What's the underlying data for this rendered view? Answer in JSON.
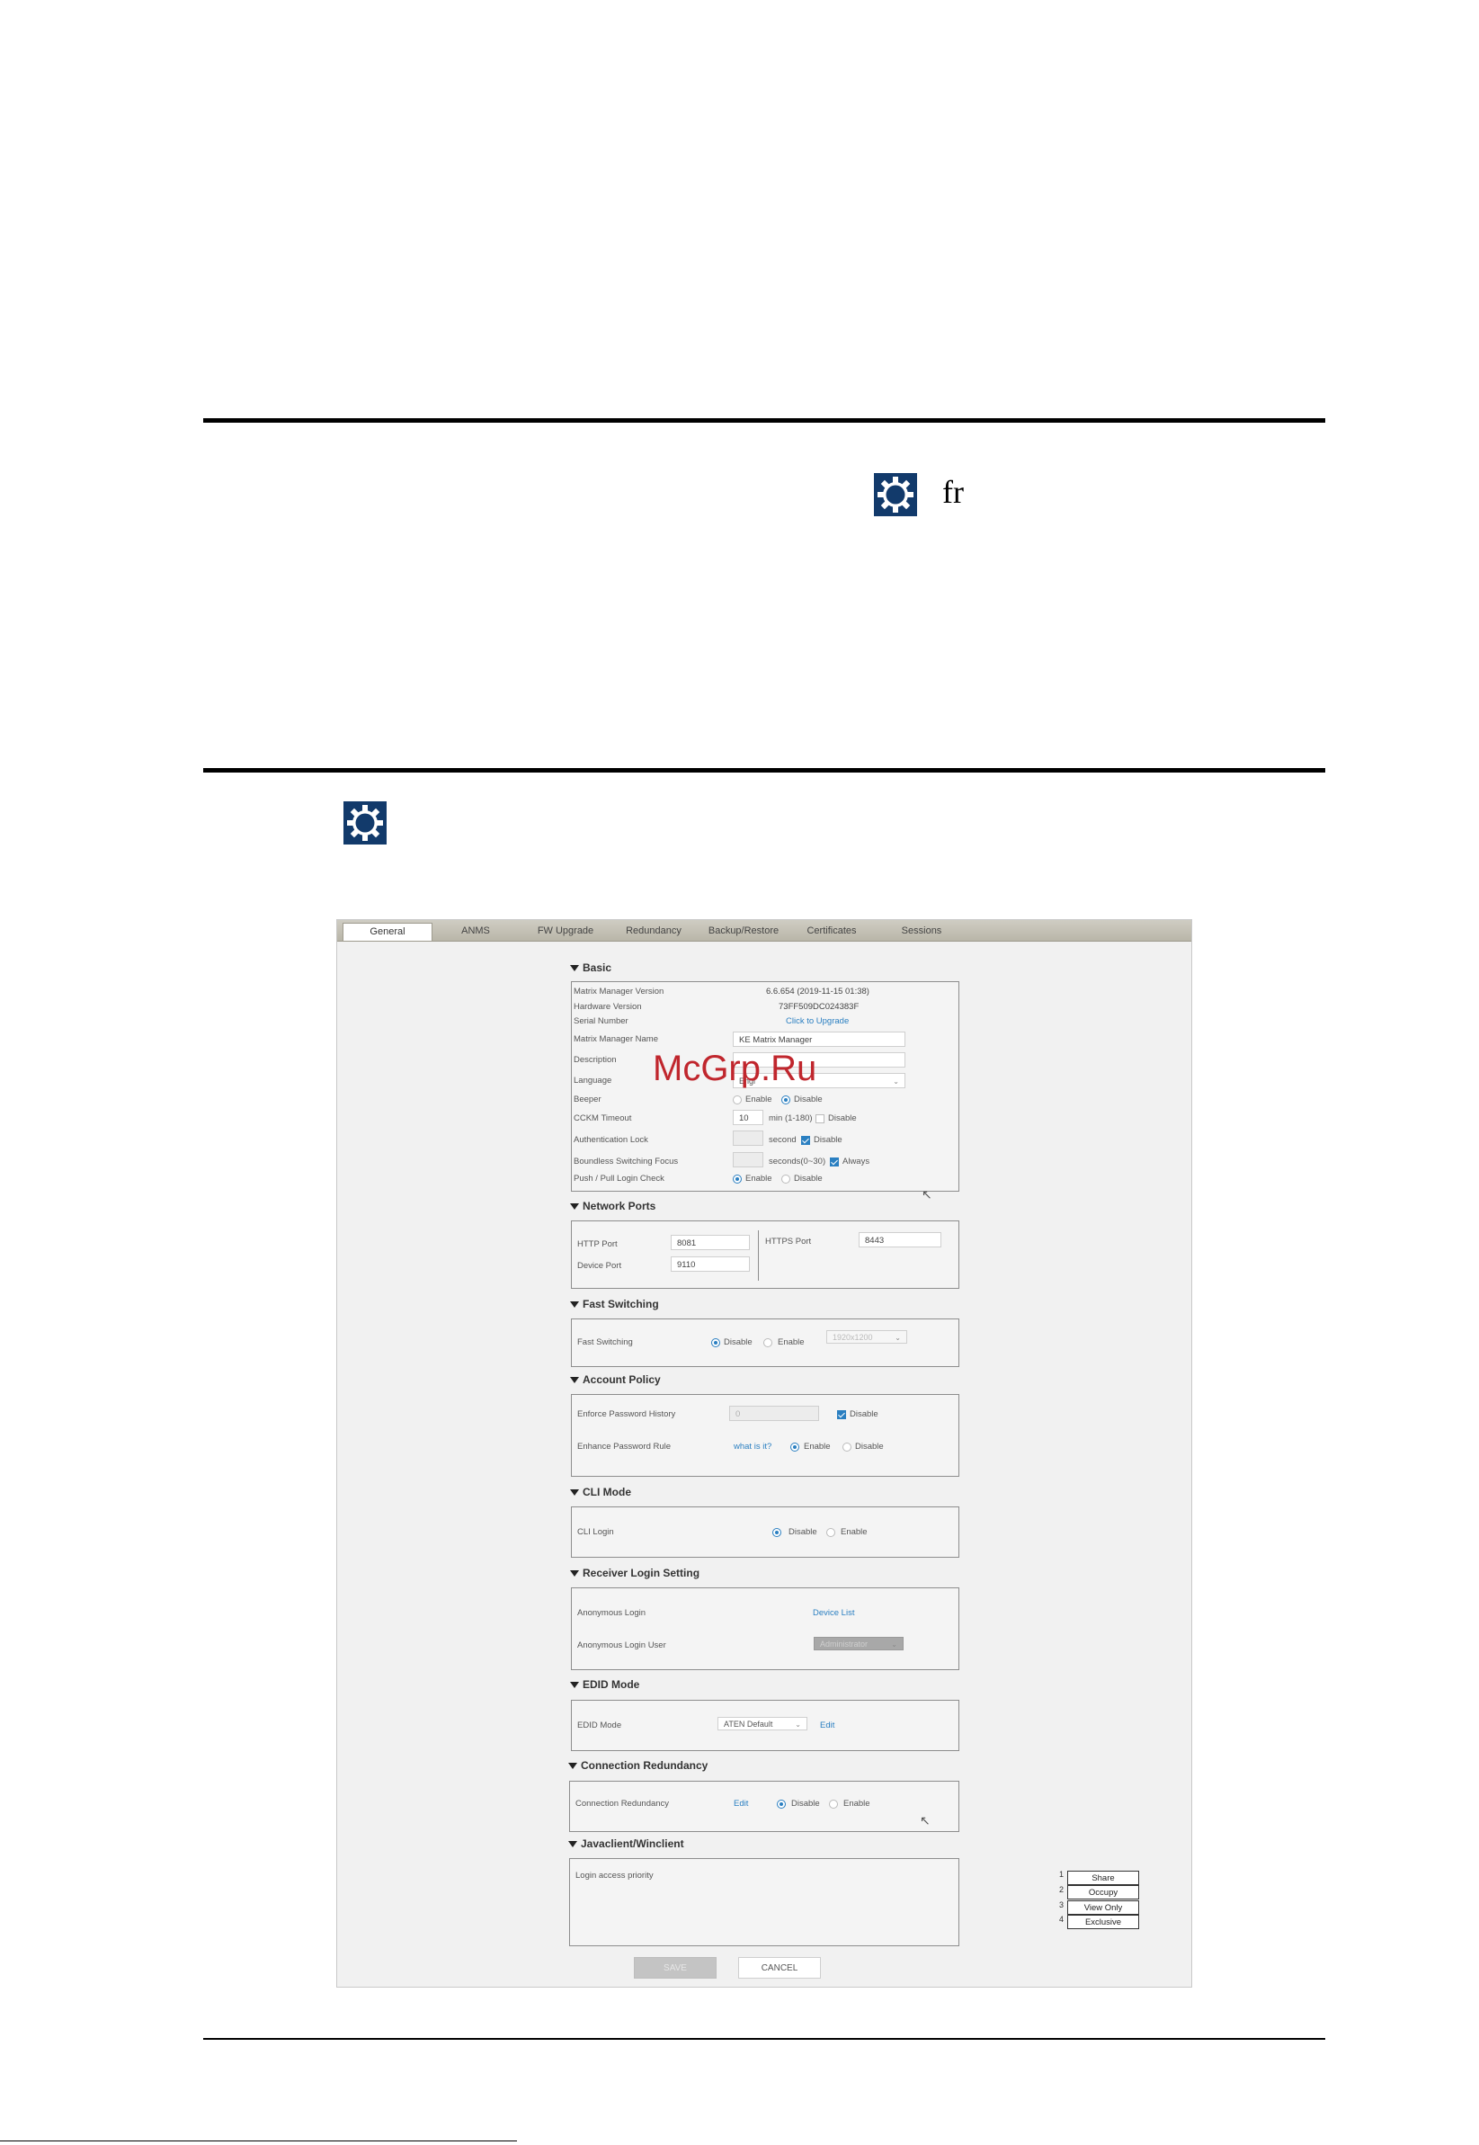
{
  "doc": {
    "inline_text": "fr",
    "watermark": "McGrp.Ru"
  },
  "ui": {
    "tabs": [
      "General",
      "ANMS",
      "FW Upgrade",
      "Redundancy",
      "Backup/Restore",
      "Certificates",
      "Sessions"
    ],
    "active_tab": "General",
    "basic": {
      "title": "Basic",
      "mm_version_label": "Matrix Manager Version",
      "mm_version_value": "6.6.654 (2019-11-15 01:38)",
      "hw_version_label": "Hardware Version",
      "hw_version_value": "73FF509DC024383F",
      "serial_label": "Serial Number",
      "serial_link": "Click to Upgrade",
      "name_label": "Matrix Manager Name",
      "name_value": "KE Matrix Manager",
      "desc_label": "Description",
      "desc_value": "",
      "lang_label": "Language",
      "lang_value": "Engl",
      "beeper_label": "Beeper",
      "beeper_enable": "Enable",
      "beeper_disable": "Disable",
      "cckm_label": "CCKM Timeout",
      "cckm_value": "10",
      "cckm_unit": "min (1-180)",
      "cckm_disable": "Disable",
      "auth_label": "Authentication Lock",
      "auth_unit": "second",
      "auth_disable": "Disable",
      "bsf_label": "Boundless Switching Focus",
      "bsf_unit": "seconds(0~30)",
      "bsf_always": "Always",
      "push_label": "Push / Pull Login Check",
      "push_enable": "Enable",
      "push_disable": "Disable"
    },
    "network": {
      "title": "Network Ports",
      "http_label": "HTTP Port",
      "http_value": "8081",
      "device_label": "Device Port",
      "device_value": "9110",
      "https_label": "HTTPS Port",
      "https_value": "8443"
    },
    "fast": {
      "title": "Fast Switching",
      "label": "Fast Switching",
      "disable": "Disable",
      "enable": "Enable",
      "resolution": "1920x1200"
    },
    "account": {
      "title": "Account Policy",
      "history_label": "Enforce Password History",
      "history_value": "0",
      "history_disable": "Disable",
      "rule_label": "Enhance Password Rule",
      "rule_link": "what is it?",
      "rule_enable": "Enable",
      "rule_disable": "Disable"
    },
    "cli": {
      "title": "CLI Mode",
      "label": "CLI Login",
      "disable": "Disable",
      "enable": "Enable"
    },
    "receiver": {
      "title": "Receiver Login Setting",
      "anon_label": "Anonymous Login",
      "anon_link": "Device List",
      "user_label": "Anonymous Login User",
      "user_value": "Administrator"
    },
    "edid": {
      "title": "EDID Mode",
      "label": "EDID Mode",
      "value": "ATEN Default",
      "edit": "Edit"
    },
    "conn": {
      "title": "Connection Redundancy",
      "label": "Connection Redundancy",
      "edit": "Edit",
      "disable": "Disable",
      "enable": "Enable"
    },
    "java": {
      "title": "Javaclient/Winclient",
      "label": "Login access priority",
      "numbers": [
        "1",
        "2",
        "3",
        "4"
      ],
      "items": [
        "Share",
        "Occupy",
        "View Only",
        "Exclusive"
      ]
    },
    "save": "SAVE",
    "cancel": "CANCEL"
  },
  "colors": {
    "accent": "#2a7fc1",
    "gear_icon": "#123a6b",
    "watermark": "#c0262d"
  }
}
